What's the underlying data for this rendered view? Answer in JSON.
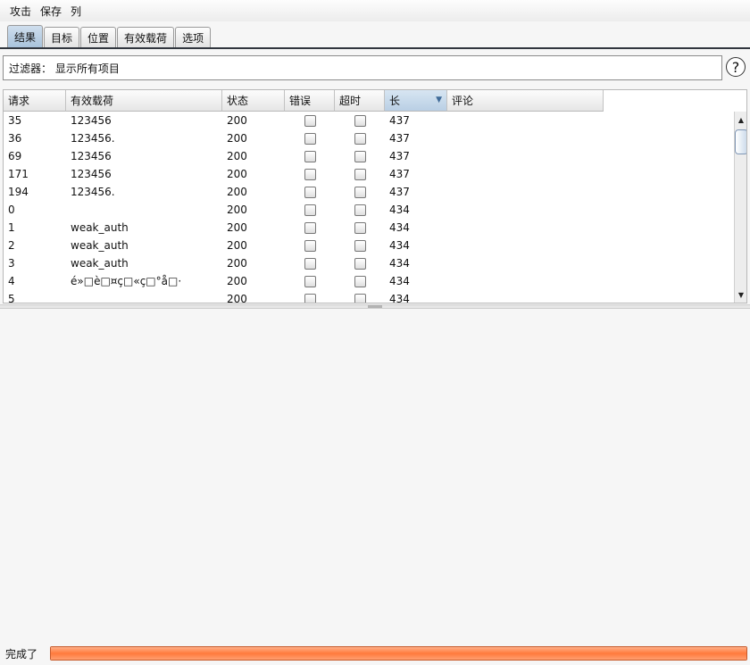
{
  "menu": {
    "attack": "攻击",
    "save": "保存",
    "columns": "列"
  },
  "tabs": [
    "结果",
    "目标",
    "位置",
    "有效载荷",
    "选项"
  ],
  "filter": {
    "text": "过滤器：  显示所有项目",
    "help": "?"
  },
  "table": {
    "headers": [
      "请求",
      "有效载荷",
      "状态",
      "错误",
      "超时",
      "长",
      "评论"
    ],
    "rows": [
      {
        "request": "35",
        "payload": "123456",
        "status": "200",
        "length": "437"
      },
      {
        "request": "36",
        "payload": "123456.",
        "status": "200",
        "length": "437"
      },
      {
        "request": "69",
        "payload": "123456",
        "status": "200",
        "length": "437"
      },
      {
        "request": "171",
        "payload": "123456",
        "status": "200",
        "length": "437"
      },
      {
        "request": "194",
        "payload": "123456.",
        "status": "200",
        "length": "437"
      },
      {
        "request": "0",
        "payload": "",
        "status": "200",
        "length": "434"
      },
      {
        "request": "1",
        "payload": "weak_auth",
        "status": "200",
        "length": "434"
      },
      {
        "request": "2",
        "payload": "weak_auth",
        "status": "200",
        "length": "434"
      },
      {
        "request": "3",
        "payload": "weak_auth",
        "status": "200",
        "length": "434"
      },
      {
        "request": "4",
        "payload": "é»□è□¤ç□«ç□°å□·",
        "status": "200",
        "length": "434"
      },
      {
        "request": "5",
        "payload": "",
        "status": "200",
        "length": "434"
      }
    ]
  },
  "status": {
    "text": "完成了",
    "progress": 1.0
  }
}
